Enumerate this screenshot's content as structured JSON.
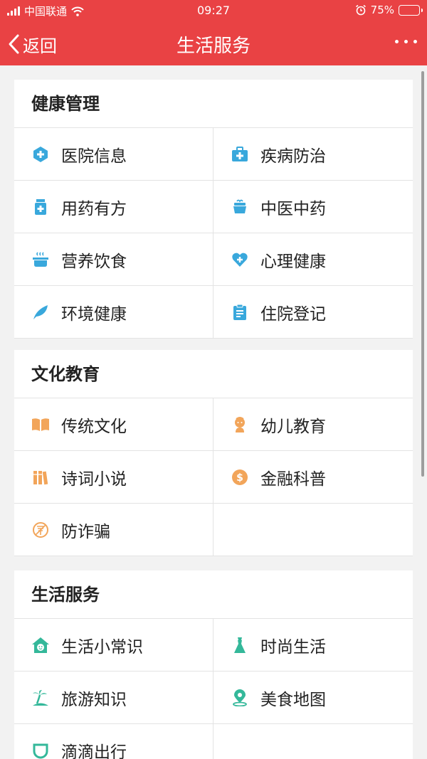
{
  "status_bar": {
    "carrier": "中国联通",
    "time": "09:27",
    "battery": "75%",
    "battery_level": 0.75
  },
  "nav": {
    "back_label": "返回",
    "title": "生活服务"
  },
  "colors": {
    "header": "#e94244",
    "health": "#39a8dc",
    "culture": "#f2a55a",
    "life": "#34b89a"
  },
  "sections": [
    {
      "title": "健康管理",
      "items": [
        {
          "label": "医院信息",
          "icon": "hospital-icon"
        },
        {
          "label": "疾病防治",
          "icon": "medical-kit-icon"
        },
        {
          "label": "用药有方",
          "icon": "medicine-bottle-icon"
        },
        {
          "label": "中医中药",
          "icon": "herbal-pot-icon"
        },
        {
          "label": "营养饮食",
          "icon": "cooking-pot-icon"
        },
        {
          "label": "心理健康",
          "icon": "heart-plus-icon"
        },
        {
          "label": "环境健康",
          "icon": "leaf-icon"
        },
        {
          "label": "住院登记",
          "icon": "clipboard-icon"
        }
      ]
    },
    {
      "title": "文化教育",
      "items": [
        {
          "label": "传统文化",
          "icon": "open-book-icon"
        },
        {
          "label": "幼儿教育",
          "icon": "child-icon"
        },
        {
          "label": "诗词小说",
          "icon": "books-icon"
        },
        {
          "label": "金融科普",
          "icon": "dollar-coin-icon"
        },
        {
          "label": "防诈骗",
          "icon": "no-fraud-icon"
        }
      ]
    },
    {
      "title": "生活服务",
      "items": [
        {
          "label": "生活小常识",
          "icon": "house-face-icon"
        },
        {
          "label": "时尚生活",
          "icon": "dress-icon"
        },
        {
          "label": "旅游知识",
          "icon": "palm-tree-icon"
        },
        {
          "label": "美食地图",
          "icon": "map-pin-icon"
        },
        {
          "label": "滴滴出行",
          "icon": "didi-icon"
        }
      ]
    }
  ]
}
